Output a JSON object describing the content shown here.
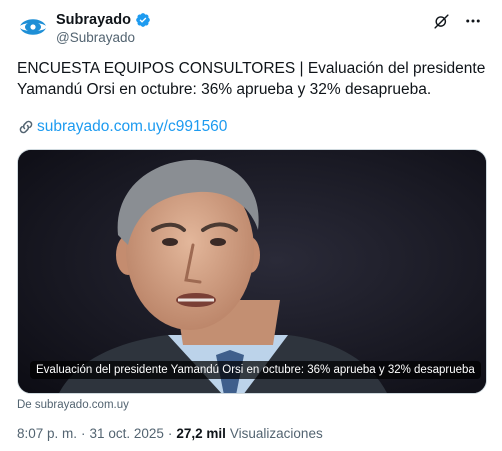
{
  "author": {
    "display_name": "Subrayado",
    "handle": "@Subrayado",
    "verified": true,
    "avatar_icon": "subrayado-logo-icon"
  },
  "tweet": {
    "text": "ENCUESTA EQUIPOS CONSULTORES | Evaluación del presidente Yamandú Orsi en octubre: 36% aprueba y 32% desaprueba.",
    "link_text": "subrayado.com.uy/c991560",
    "media_caption": "Evaluación del presidente Yamandú Orsi en octubre: 36% aprueba y 32% desaprueba",
    "source": "De subrayado.com.uy"
  },
  "meta": {
    "time": "8:07 p. m.",
    "separator": "·",
    "date": "31 oct. 2025",
    "views_count": "27,2 mil",
    "views_label": "Visualizaciones"
  },
  "colors": {
    "accent": "#1d9bf0",
    "secondary_text": "#536471",
    "primary_text": "#0f1419"
  },
  "icons": [
    "subrayado-logo-icon",
    "verified-badge-icon",
    "grok-icon",
    "more-icon",
    "link-icon"
  ]
}
